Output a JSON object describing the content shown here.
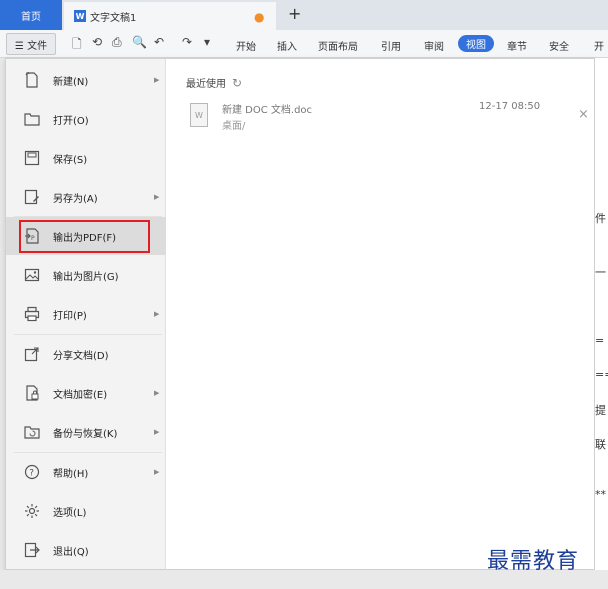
{
  "tabs": {
    "home": "首页",
    "doc_icon_letter": "W",
    "doc_title": "文字文稿1",
    "unsaved_dot": "●",
    "new_tab": "+"
  },
  "menubar": {
    "file_button": "☰ 文件",
    "quick_access": [
      "🗋",
      "⟲",
      "⎙",
      "🔍",
      "↶",
      "↷",
      "▾"
    ],
    "items": [
      "开始",
      "插入",
      "页面布局",
      "引用",
      "审阅",
      "视图",
      "章节",
      "安全",
      "开"
    ],
    "active_item": "视图"
  },
  "file_menu": {
    "items": [
      {
        "label": "新建(N)",
        "icon": "new-doc-icon",
        "has_submenu": true
      },
      {
        "label": "打开(O)",
        "icon": "folder-open-icon",
        "has_submenu": false
      },
      {
        "label": "保存(S)",
        "icon": "save-icon",
        "has_submenu": false
      },
      {
        "label": "另存为(A)",
        "icon": "save-as-icon",
        "has_submenu": true
      },
      {
        "label": "输出为PDF(F)",
        "icon": "export-pdf-icon",
        "has_submenu": false
      },
      {
        "label": "输出为图片(G)",
        "icon": "export-image-icon",
        "has_submenu": false
      },
      {
        "label": "打印(P)",
        "icon": "print-icon",
        "has_submenu": true
      },
      {
        "label": "分享文档(D)",
        "icon": "share-icon",
        "has_submenu": false
      },
      {
        "label": "文档加密(E)",
        "icon": "encrypt-icon",
        "has_submenu": true
      },
      {
        "label": "备份与恢复(K)",
        "icon": "backup-icon",
        "has_submenu": true
      },
      {
        "label": "帮助(H)",
        "icon": "help-icon",
        "has_submenu": true
      },
      {
        "label": "选项(L)",
        "icon": "gear-icon",
        "has_submenu": false
      },
      {
        "label": "退出(Q)",
        "icon": "exit-icon",
        "has_submenu": false
      }
    ],
    "highlighted": "输出为PDF(F)",
    "submenu_arrow": "▶"
  },
  "recent": {
    "title": "最近使用",
    "refresh_icon": "↻",
    "files": [
      {
        "name": "新建 DOC 文档.doc",
        "path": "桌面/",
        "time": "12-17 08:50",
        "close": "×",
        "icon_letter": "W"
      }
    ]
  },
  "doc_strip": [
    "件",
    "一",
    "=",
    "==",
    "提",
    "联",
    "**"
  ],
  "watermark": "最需教育",
  "colors": {
    "accent": "#2f6fd8",
    "highlight_border": "#e02020",
    "watermark": "#1e3f98"
  }
}
